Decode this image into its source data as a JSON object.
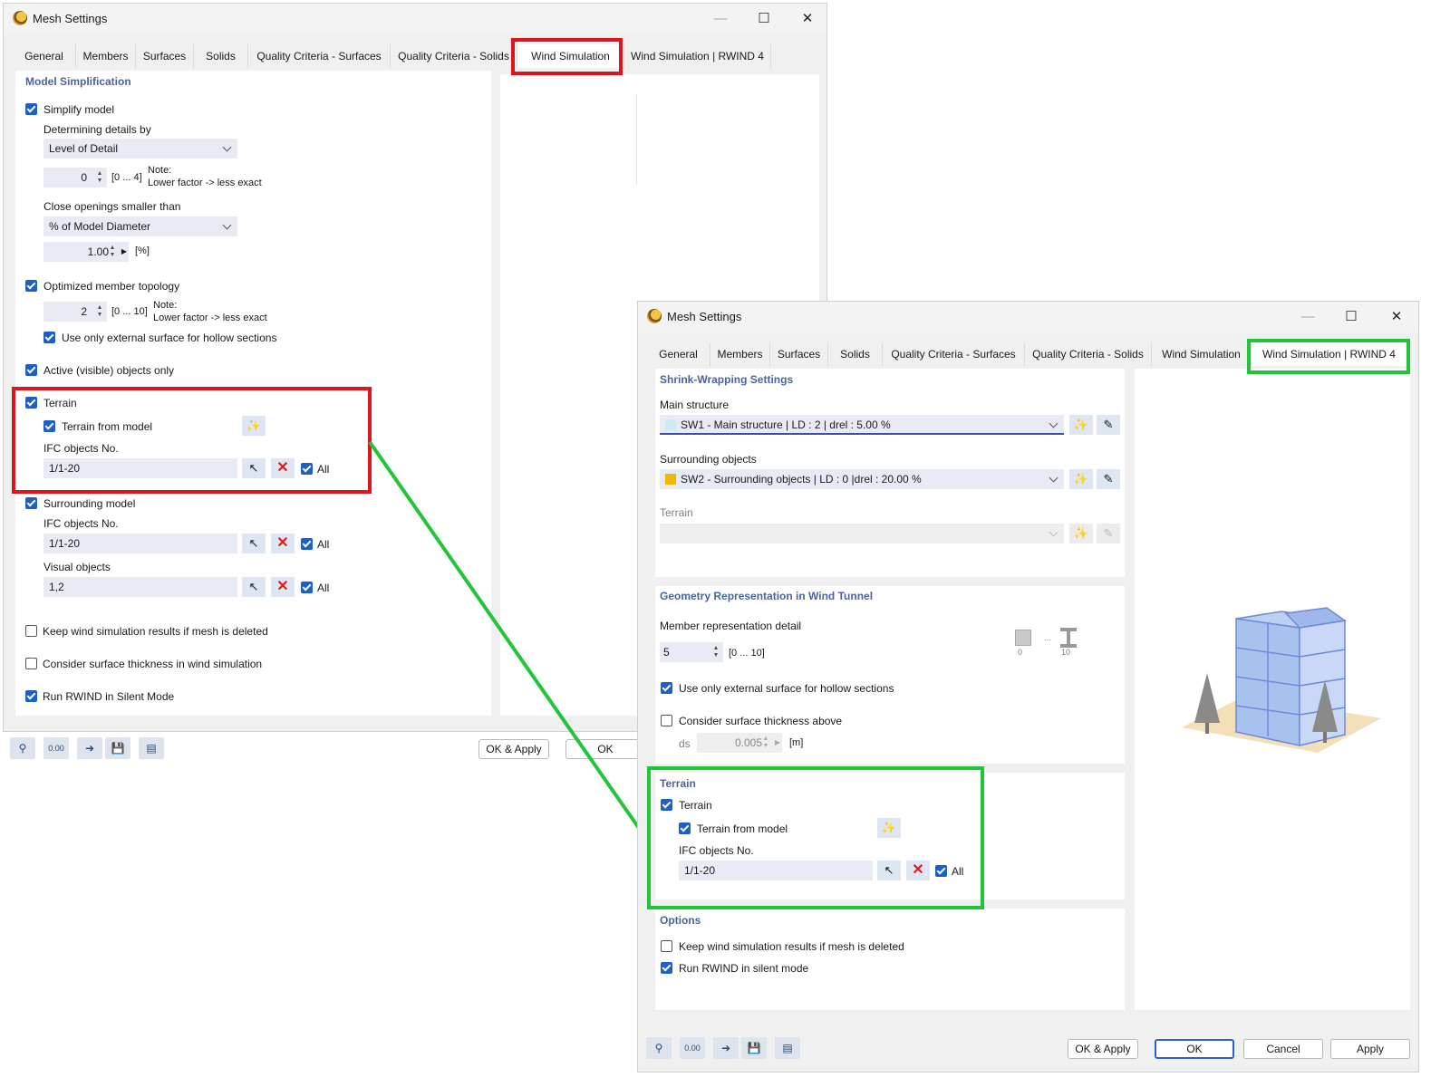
{
  "w1": {
    "title": "Mesh Settings",
    "tabs": [
      "General",
      "Members",
      "Surfaces",
      "Solids",
      "Quality Criteria - Surfaces",
      "Quality Criteria - Solids",
      "Wind Simulation",
      "Wind Simulation | RWIND 4"
    ],
    "active_tab": "Wind Simulation",
    "section_model_simplification": "Model Simplification",
    "simplify_model": "Simplify model",
    "determining_details_by": "Determining details by",
    "level_of_detail": "Level of Detail",
    "lod_value": "0",
    "lod_range": "[0 ... 4]",
    "note": "Note:",
    "note_text": "Lower factor -> less exact",
    "close_openings": "Close openings smaller than",
    "pct_model_diameter": "% of Model Diameter",
    "close_value": "1.00",
    "close_unit": "[%]",
    "optimized_topology": "Optimized member topology",
    "topology_value": "2",
    "topology_range": "[0 ... 10]",
    "use_external_surface": "Use only external surface for hollow sections",
    "active_visible_only": "Active (visible) objects only",
    "terrain": "Terrain",
    "terrain_from_model": "Terrain from model",
    "ifc_objects_no": "IFC objects No.",
    "ifc_value": "1/1-20",
    "all": "All",
    "surrounding_model": "Surrounding model",
    "surrounding_ifc_value": "1/1-20",
    "visual_objects": "Visual objects",
    "visual_value": "1,2",
    "keep_results": "Keep wind simulation results if mesh is deleted",
    "consider_thickness": "Consider surface thickness in wind simulation",
    "run_silent": "Run RWIND in Silent Mode",
    "ok_apply": "OK & Apply",
    "ok": "OK"
  },
  "w2": {
    "title": "Mesh Settings",
    "tabs": [
      "General",
      "Members",
      "Surfaces",
      "Solids",
      "Quality Criteria - Surfaces",
      "Quality Criteria - Solids",
      "Wind Simulation",
      "Wind Simulation | RWIND 4"
    ],
    "active_tab": "Wind Simulation | RWIND 4",
    "section_shrink": "Shrink-Wrapping Settings",
    "main_structure": "Main structure",
    "main_value": "SW1 - Main structure | LD : 2 | drel : 5.00 %",
    "main_color": "#cfe9f7",
    "surrounding_objects": "Surrounding objects",
    "surr_value": "SW2 - Surrounding objects | LD : 0 |drel : 20.00 %",
    "surr_color": "#f2b705",
    "terrain_label": "Terrain",
    "section_geometry": "Geometry Representation in Wind Tunnel",
    "member_detail": "Member representation detail",
    "member_value": "5",
    "member_range": "[0 ... 10]",
    "icon_min_label": "0",
    "icon_max_label": "10",
    "use_external_surface": "Use only external surface for hollow sections",
    "consider_thickness_above": "Consider surface thickness above",
    "ds_label": "ds",
    "ds_value": "0.005",
    "ds_unit": "[m]",
    "section_terrain": "Terrain",
    "terrain": "Terrain",
    "terrain_from_model": "Terrain from model",
    "ifc_objects_no": "IFC objects No.",
    "ifc_value": "1/1-20",
    "all": "All",
    "section_options": "Options",
    "keep_results": "Keep wind simulation results if mesh is deleted",
    "run_silent": "Run RWIND in silent mode",
    "ok_apply": "OK & Apply",
    "ok": "OK",
    "cancel": "Cancel",
    "apply": "Apply"
  },
  "icons": [
    "search-icon",
    "units-icon",
    "arrow-model-icon",
    "save-icon",
    "copy-icon",
    "new-item-icon",
    "edit-item-icon",
    "pick-cursor-icon",
    "delete-x-icon",
    "building-preview-icon"
  ],
  "colors": {
    "accent": "#1c5fc7",
    "section": "#4a64a0",
    "highlight_red": "#e0141e",
    "highlight_green": "#22c43a",
    "connector": "#22c43a"
  }
}
